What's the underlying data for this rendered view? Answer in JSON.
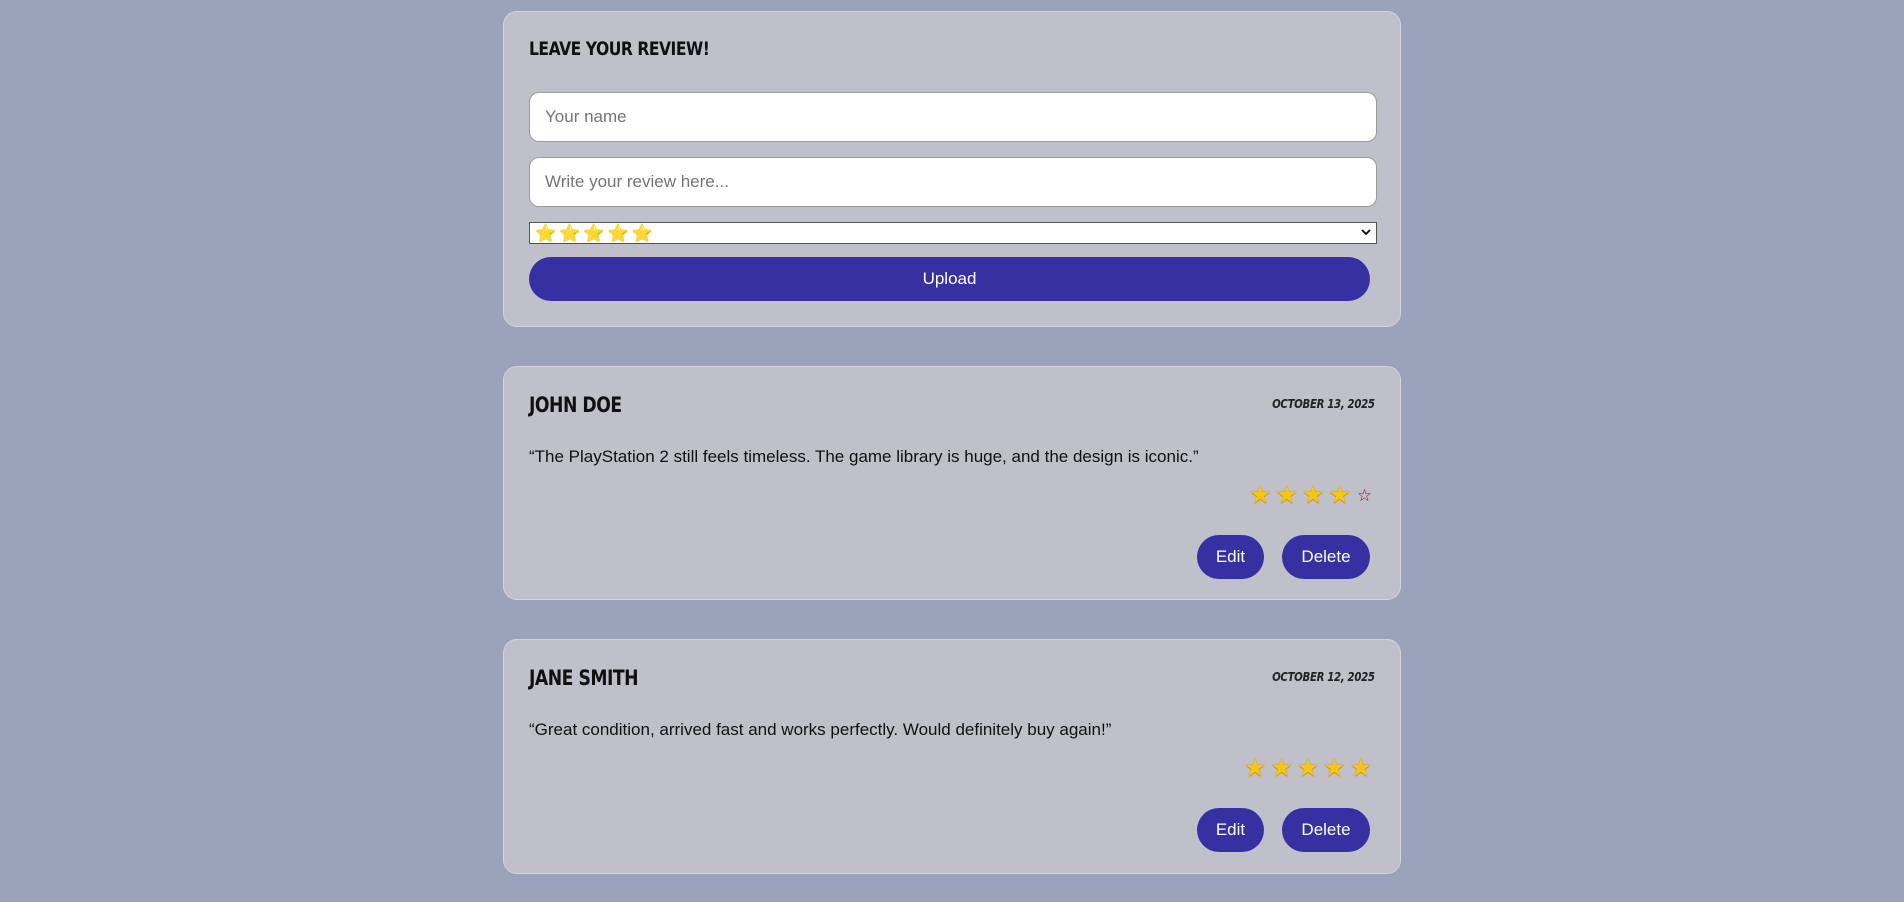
{
  "form": {
    "title": "Leave your review!",
    "name_placeholder": "Your name",
    "review_placeholder": "Write your review here...",
    "rating_selected": "⭐⭐⭐⭐⭐",
    "rating_selected_count": 5,
    "upload_label": "Upload"
  },
  "reviews": [
    {
      "name": "John Doe",
      "date": "October 13, 2025",
      "text": "“The PlayStation 2 still feels timeless. The game library is huge, and the design is iconic.”",
      "rating": 4,
      "max_rating": 5,
      "edit_label": "Edit",
      "delete_label": "Delete"
    },
    {
      "name": "Jane Smith",
      "date": "October 12, 2025",
      "text": "“Great condition, arrived fast and works perfectly. Would definitely buy again!”",
      "rating": 5,
      "max_rating": 5,
      "edit_label": "Edit",
      "delete_label": "Delete"
    }
  ],
  "colors": {
    "background": "#9aa3b9",
    "card": "#c0c0ca",
    "accent": "#3730a3",
    "star": "#f5c518",
    "empty_star": "#b00020"
  },
  "icons": {
    "rating_select_arrow": "chevron-down-icon",
    "full_star": "star-icon",
    "empty_star": "star-outline-icon"
  }
}
